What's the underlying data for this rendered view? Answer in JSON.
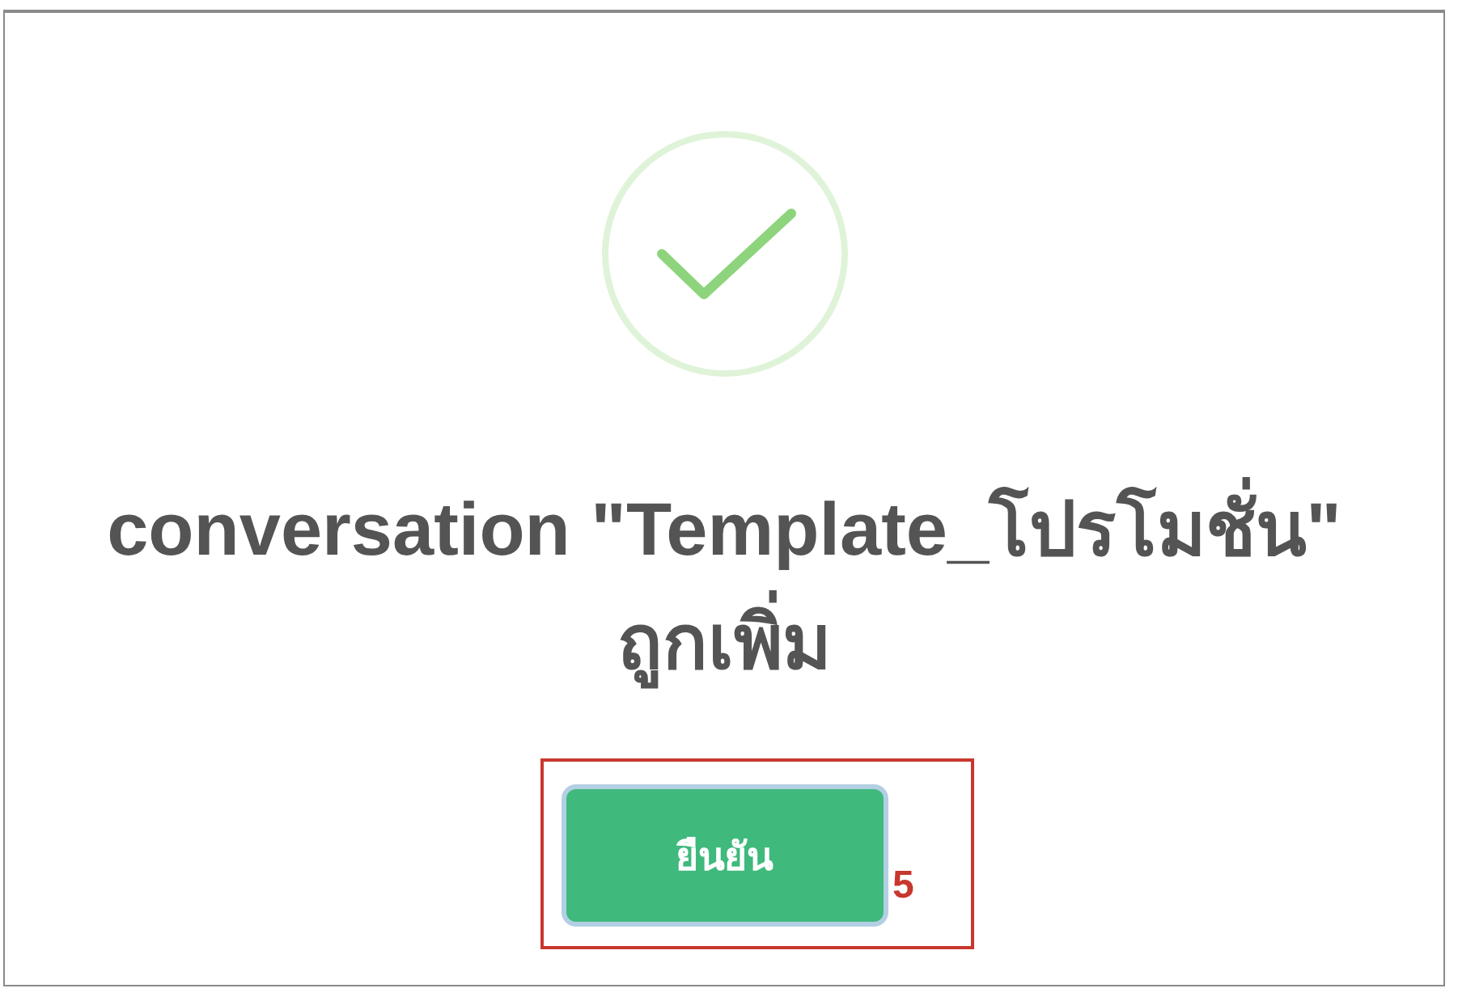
{
  "dialog": {
    "message": "conversation \"Template_โปรโมชั่น\" ถูกเพิ่ม",
    "button": {
      "label": "ยืนยัน",
      "focused": true
    }
  },
  "annotation": {
    "label": "5"
  }
}
